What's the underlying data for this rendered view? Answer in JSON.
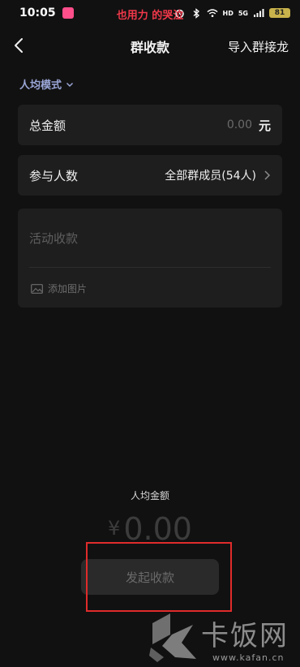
{
  "status_bar": {
    "time": "10:05",
    "caption": "也用力 的哭泣",
    "network_label": "HD",
    "signal_label": "5G",
    "battery": "81",
    "icons": [
      "alarm-icon",
      "bluetooth-icon",
      "wifi-icon",
      "signal-icon",
      "battery-icon"
    ]
  },
  "nav": {
    "title": "群收款",
    "action": "导入群接龙"
  },
  "mode": {
    "label": "人均模式"
  },
  "total": {
    "label": "总金额",
    "placeholder": "0.00",
    "unit": "元"
  },
  "participants": {
    "label": "参与人数",
    "value": "全部群成员(54人)"
  },
  "note": {
    "placeholder": "活动收款",
    "add_image": "添加图片"
  },
  "per_person": {
    "label": "人均金额",
    "currency": "¥",
    "amount": "0.00"
  },
  "submit": {
    "label": "发起收款"
  },
  "watermark": {
    "title": "卡饭网",
    "url": "www.kafan.cn"
  },
  "colors": {
    "background": "#111111",
    "card": "#1e1e1e",
    "accent_mode": "#9aa6d6",
    "highlight": "#e02b2b",
    "caption": "#f0384a"
  }
}
